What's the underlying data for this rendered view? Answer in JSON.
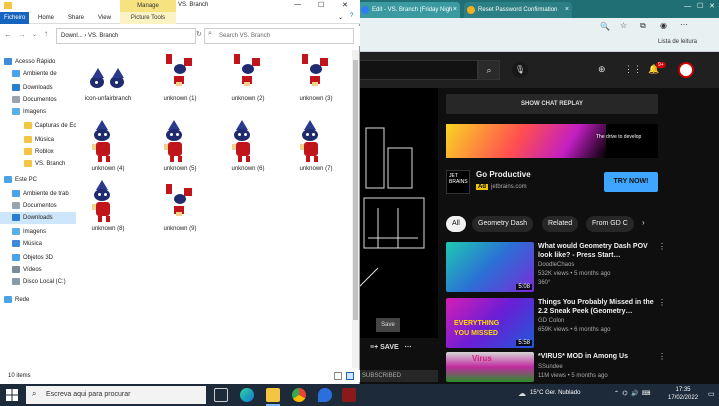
{
  "explorer": {
    "title": "VS. Branch",
    "tabs": [
      "Ficheiro",
      "Home",
      "Share",
      "View",
      "Picture Tools"
    ],
    "manage": "Manage",
    "path": [
      "Downl...",
      "VS. Branch"
    ],
    "search_placeholder": "Search VS. Branch",
    "nav": [
      {
        "label": "Acesso Rápido",
        "icon": "star-icon",
        "color": "#3d8bd9"
      },
      {
        "label": "Ambiente de",
        "icon": "desktop-icon",
        "color": "#4aa3e6"
      },
      {
        "label": "Downloads",
        "icon": "download-icon",
        "color": "#2b7dd4"
      },
      {
        "label": "Documentos",
        "icon": "document-icon",
        "color": "#9aa4ad"
      },
      {
        "label": "Imagens",
        "icon": "pictures-icon",
        "color": "#5ab0e6"
      },
      {
        "label": "Capturas de Ecrã",
        "icon": "folder-icon",
        "color": "#f4c542"
      },
      {
        "label": "Música",
        "icon": "music-icon",
        "color": "#f4c542"
      },
      {
        "label": "Roblox",
        "icon": "folder-icon",
        "color": "#f4c542"
      },
      {
        "label": "VS. Branch",
        "icon": "folder-icon",
        "color": "#f4c542"
      },
      {
        "label": "Este PC",
        "icon": "pc-icon",
        "color": "#4aa3e6"
      },
      {
        "label": "Ambiente de trab",
        "icon": "desktop-icon",
        "color": "#4aa3e6"
      },
      {
        "label": "Documentos",
        "icon": "document-icon",
        "color": "#9aa4ad"
      },
      {
        "label": "Downloads",
        "icon": "download-icon",
        "color": "#2b7dd4"
      },
      {
        "label": "Imagens",
        "icon": "pictures-icon",
        "color": "#5ab0e6"
      },
      {
        "label": "Música",
        "icon": "music-icon",
        "color": "#3d8bd9"
      },
      {
        "label": "Objetos 3D",
        "icon": "cube-icon",
        "color": "#4aa3e6"
      },
      {
        "label": "Vídeos",
        "icon": "video-icon",
        "color": "#7f8c98"
      },
      {
        "label": "Disco Local (C:)",
        "icon": "drive-icon",
        "color": "#8a9aa8"
      },
      {
        "label": "Rede",
        "icon": "network-icon",
        "color": "#4aa3e6"
      }
    ],
    "files": [
      "icon-unfairbranch",
      "unknown (1)",
      "unknown (2)",
      "unknown (3)",
      "unknown (4)",
      "unknown (5)",
      "unknown (6)",
      "unknown (7)",
      "unknown (8)",
      "unknown (9)"
    ],
    "status": "10 items"
  },
  "browser": {
    "tabs": [
      {
        "label": "Edit - VS. Branch (Friday Nigh",
        "fav_color": "#2f7cf6"
      },
      {
        "label": "Reset Password Confirmation",
        "fav_color": "#f0b020"
      }
    ],
    "new_tab": "+",
    "bookmarks": "Lista de leitura",
    "notif_count": "9+",
    "chat_replay": "SHOW CHAT REPLAY",
    "ad": {
      "banner_text": "The drive to develop",
      "logo_text": "JET BRAINS",
      "title": "Go Productive",
      "label": "Ad",
      "domain": "jetbrains.com",
      "cta": "TRY NOW!"
    },
    "chips": [
      "All",
      "Geometry Dash",
      "Related",
      "From GD C"
    ],
    "save_label": "Save",
    "save_action": "SAVE",
    "videos": [
      {
        "title": "What would Geometry Dash POV look like? - Press Start…",
        "channel": "DoodleChaos",
        "meta": "532K views • 5 months ago",
        "tag": "360°",
        "duration": "5:08"
      },
      {
        "title": "Things You Probably Missed in the 2.2 Sneak Peek (Geometry…",
        "channel": "GD Colon",
        "meta": "659K views • 6 months ago",
        "tag": "",
        "duration": "5:58"
      },
      {
        "title": "*VIRUS* MOD in Among Us",
        "channel": "SSundee",
        "meta": "11M views • 5 months ago",
        "tag": "",
        "duration": ""
      }
    ],
    "thumb_text": [
      "EVERYTHING",
      "YOU MISSED",
      "Virus"
    ]
  },
  "taskbar": {
    "search_placeholder": "Escreva aqui para procurar",
    "weather": "15°C  Ger. Nublado",
    "time": "17:35",
    "date": "17/02/2022",
    "subscribed": "SUBSCRIBED"
  }
}
